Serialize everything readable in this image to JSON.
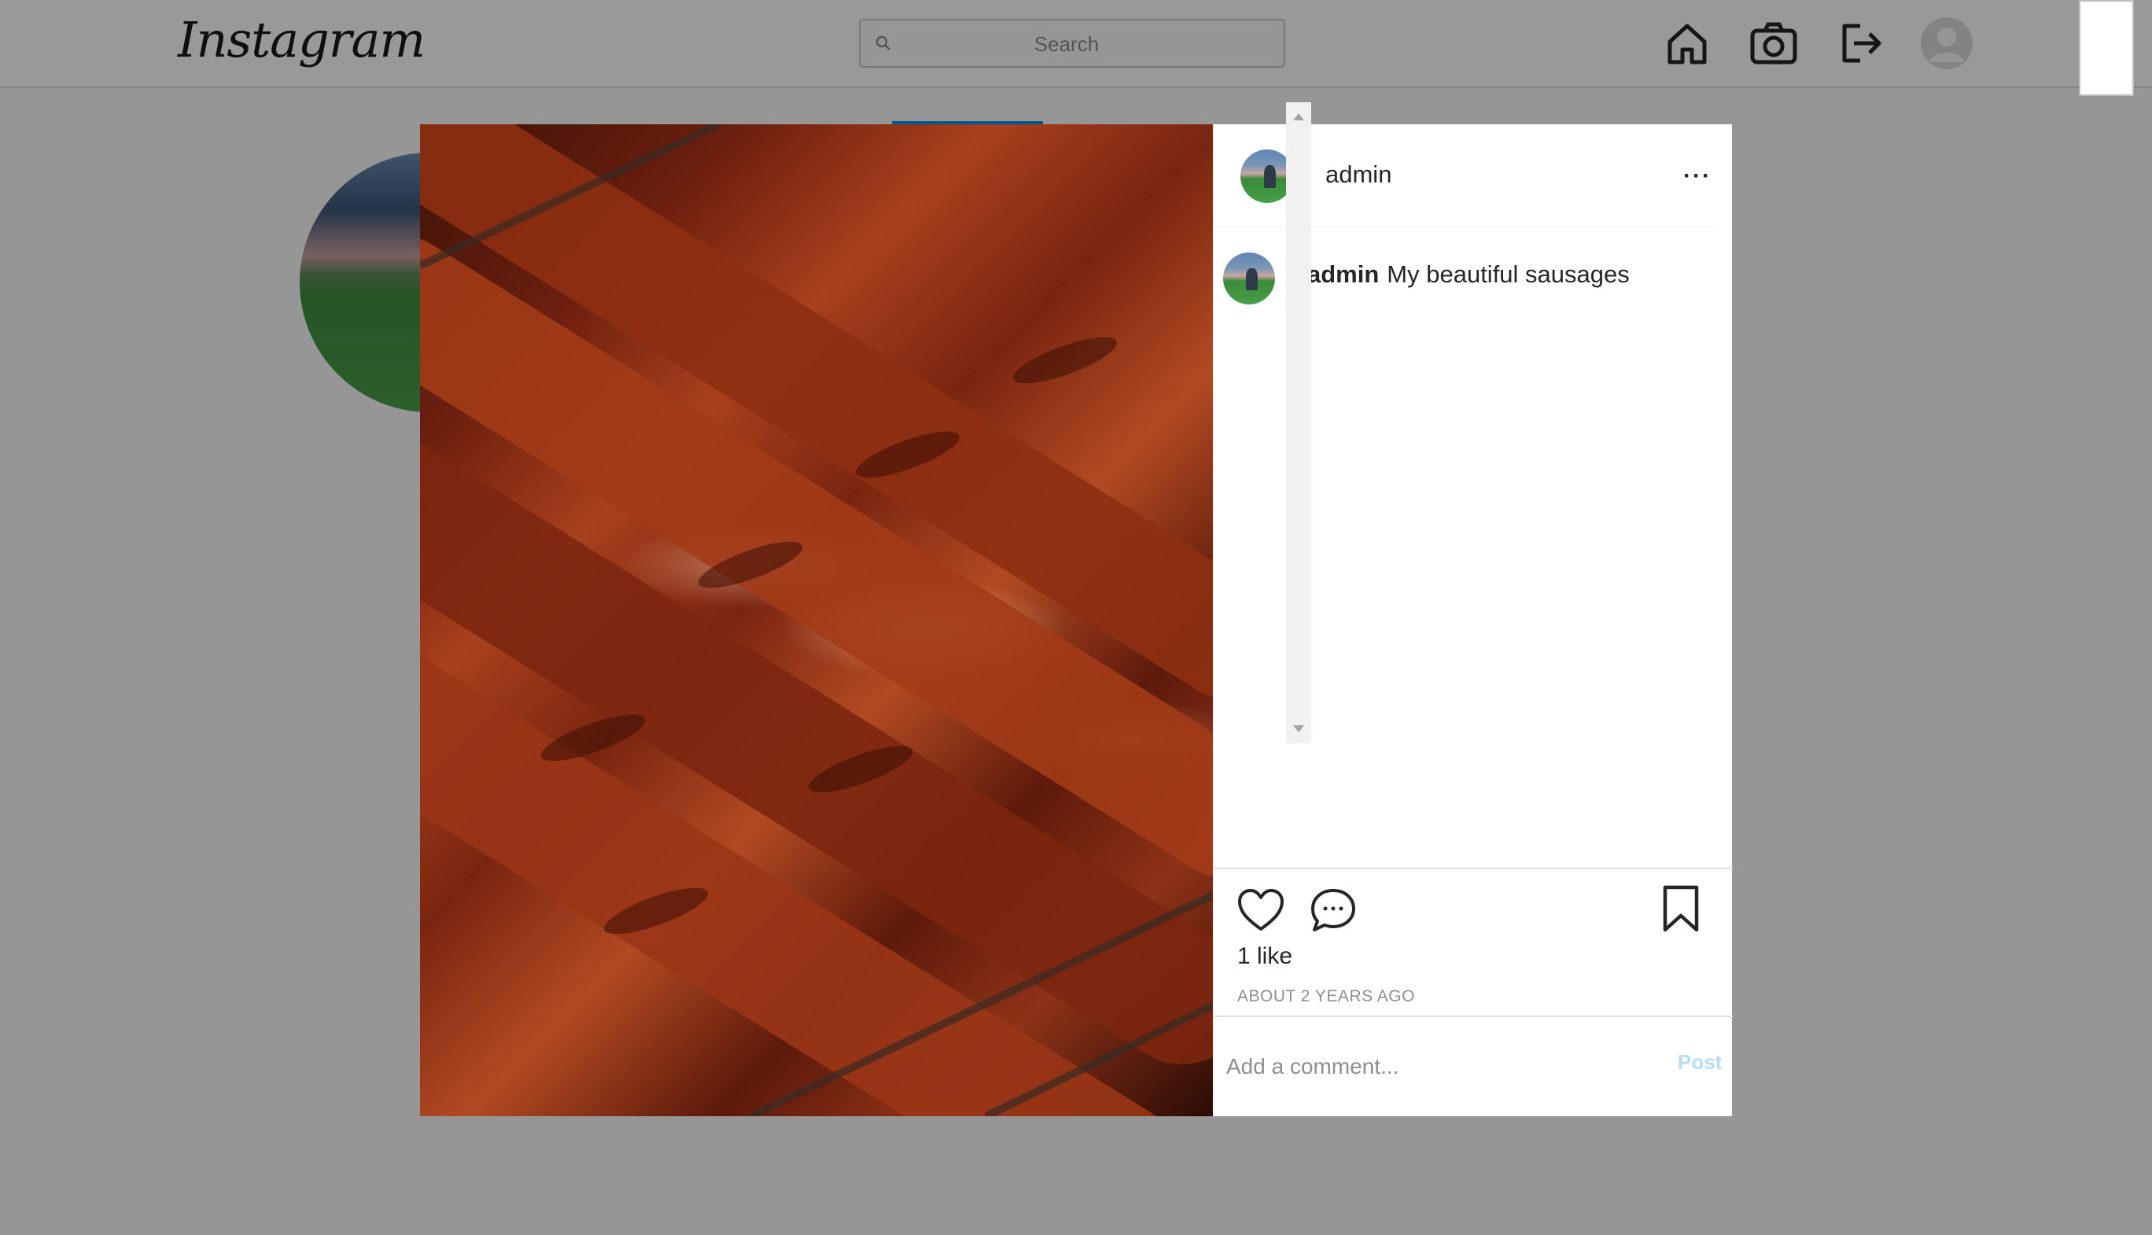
{
  "app": {
    "logo_text": "Instagram"
  },
  "nav": {
    "search_placeholder": "Search",
    "icons": [
      "home-icon",
      "camera-icon",
      "logout-icon",
      "avatar"
    ]
  },
  "post": {
    "author": "admin",
    "caption_user": "admin",
    "caption": "My beautiful sausages",
    "likes_label": "1 like",
    "timestamp": "ABOUT 2 YEARS AGO",
    "comment_placeholder": "Add a comment...",
    "post_label": "Post",
    "more_label": "···"
  },
  "colors": {
    "post_button_disabled": "#b2dffc",
    "overlay": "rgba(0,0,0,0.4)",
    "accent": "#0095f6"
  }
}
